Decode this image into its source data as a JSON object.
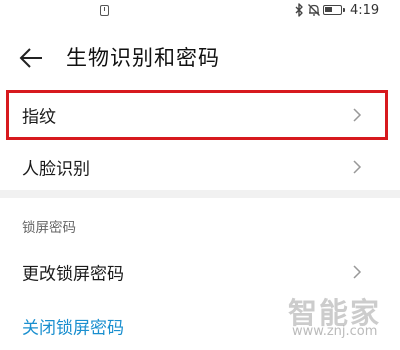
{
  "status_bar": {
    "time": "4:19",
    "battery_level": 0.5,
    "icons": [
      "notification-icon",
      "bluetooth-icon",
      "mute-icon",
      "battery-icon"
    ]
  },
  "header": {
    "title": "生物识别和密码",
    "back_icon": "arrow-left-icon"
  },
  "items": [
    {
      "label": "指纹",
      "icon": "chevron-right-icon",
      "highlighted": true
    },
    {
      "label": "人脸识别",
      "icon": "chevron-right-icon"
    }
  ],
  "lock_section": {
    "header": "锁屏密码",
    "items": [
      {
        "label": "更改锁屏密码",
        "icon": "chevron-right-icon"
      },
      {
        "label": "关闭锁屏密码",
        "link": true
      }
    ]
  },
  "watermark": {
    "text": "智能家",
    "url": "www.znj.com"
  },
  "colors": {
    "highlight": "#d7191e",
    "link": "#1a8fcf",
    "section_gap": "#f1f1f1"
  }
}
